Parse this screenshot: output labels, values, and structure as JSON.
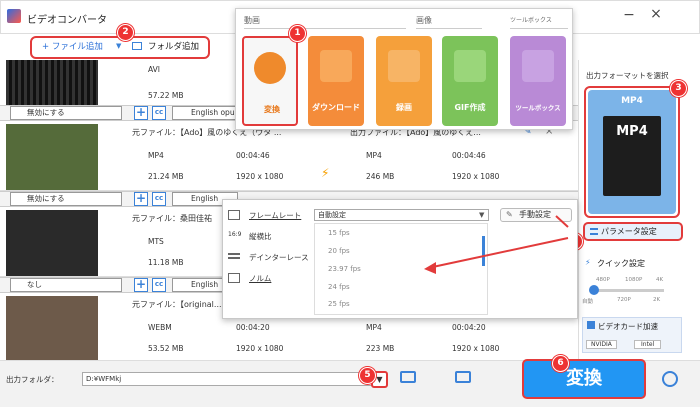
{
  "app": {
    "title": "ビデオコンバータ",
    "min_icon": "minimize-icon",
    "close_icon": "close-icon"
  },
  "toolbar": {
    "add_file": "+ ファイル追加",
    "add_folder": "フォルダ追加"
  },
  "badges": [
    "1",
    "2",
    "3",
    "4",
    "5",
    "6"
  ],
  "popup": {
    "sections": {
      "video": "動画",
      "image": "画像",
      "toolbox": "ツールボックス"
    },
    "tiles": [
      {
        "label": "変換",
        "color": "#f2f2f2",
        "icon_color": "#ef8a2c",
        "icon": "film-icon"
      },
      {
        "label": "ダウンロード",
        "color": "#f48c3a",
        "icon_color": "#f8a85a",
        "icon": "download-icon"
      },
      {
        "label": "録画",
        "color": "#f5a03b",
        "icon_color": "#f7b465",
        "icon": "screen-record-icon"
      },
      {
        "label": "GIF作成",
        "color": "#7cc35a",
        "icon_color": "#9ad67a",
        "icon": "gif-icon"
      },
      {
        "label": "ツールボックス",
        "color": "#b98ad6",
        "icon_color": "#c8a2e2",
        "icon": "toolbox-icon"
      }
    ]
  },
  "files": [
    {
      "src_name": "",
      "src_fmt": "AVI",
      "src_size": "57.22 MB",
      "out_name": "",
      "out_fmt": "",
      "out_size": ""
    },
    {
      "src_name": "元ファイル：【Ado】風のゆくえ（ウタ ...",
      "src_fmt": "MP4",
      "src_dur": "00:04:46",
      "src_size": "21.24 MB",
      "src_res": "1920 x 1080",
      "out_name": "出力ファイル：【Ado】風のゆくえ...",
      "out_fmt": "MP4",
      "out_dur": "00:04:46",
      "out_size": "246 MB",
      "out_res": "1920 x 1080"
    },
    {
      "src_name": "元ファイル：桑田佳祐",
      "src_fmt": "MTS",
      "src_size": "11.18 MB"
    },
    {
      "src_name": "元ファイル：【original...",
      "src_fmt": "WEBM",
      "src_dur": "00:04:20",
      "src_size": "53.52 MB",
      "src_res": "1920 x 1080",
      "out_fmt": "MP4",
      "out_dur": "00:04:20",
      "out_size": "223 MB",
      "out_res": "1920 x 1080"
    }
  ],
  "subtitle_bars": [
    {
      "subtitle": "無効にする",
      "audio": "English opu"
    },
    {
      "subtitle": "無効にする",
      "audio": "English"
    },
    {
      "subtitle": "なし",
      "audio": "English"
    }
  ],
  "fps_panel": {
    "framerate_label": "フレームレート",
    "aspect_label": "縦横比",
    "deinterlace_label": "デインターレース",
    "norm_label": "ノルム",
    "selected": "自動設定",
    "options": [
      "15 fps",
      "20 fps",
      "23.97 fps",
      "24 fps",
      "25 fps"
    ],
    "manual": "手動設定"
  },
  "right": {
    "format_title": "出力フォーマットを選択",
    "format": "MP4",
    "param_button": "パラメータ設定",
    "quick_title": "クイック設定",
    "ticks_top": [
      "480P",
      "1080P",
      "4K"
    ],
    "ticks_bottom": [
      "自動",
      "720P",
      "2K"
    ],
    "gpu_label": "ビデオカード加速",
    "gpu_nvidia": "NVIDIA",
    "gpu_intel": "Intel"
  },
  "bottom": {
    "folder_label": "出力フォルダ：",
    "folder_path": "D:¥WFMkj",
    "convert": "変換"
  }
}
